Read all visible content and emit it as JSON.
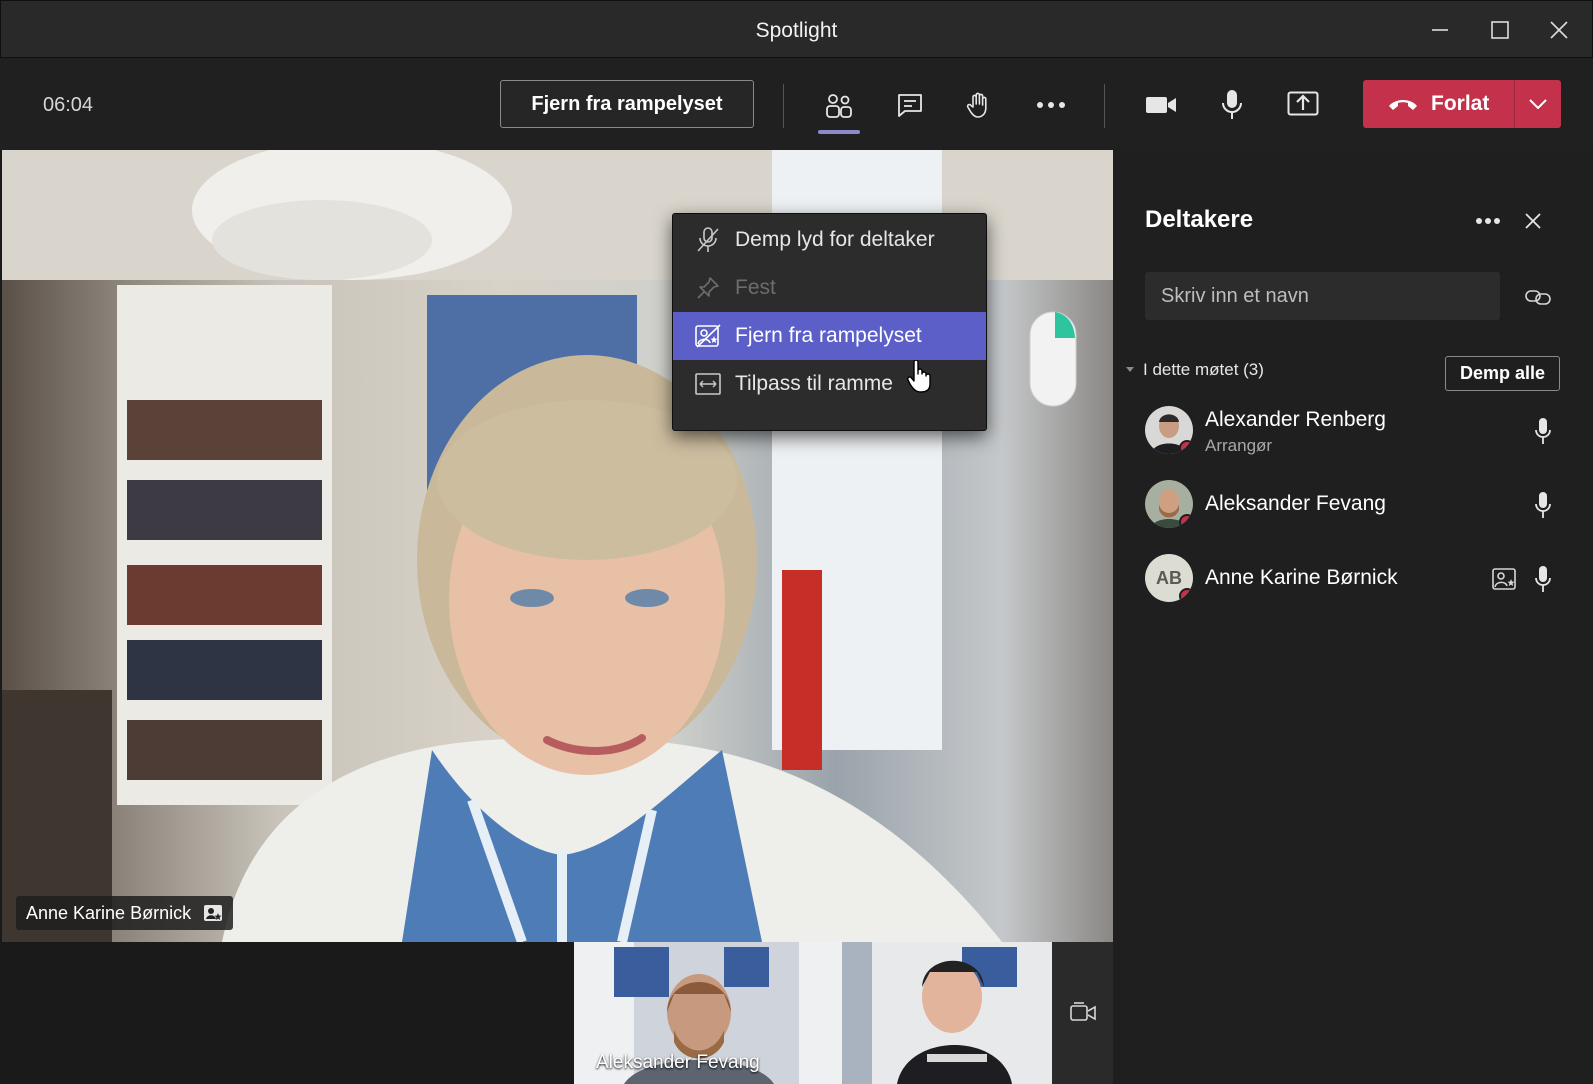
{
  "window": {
    "title": "Spotlight"
  },
  "toolbar": {
    "timer": "06:04",
    "spotlight_button": "Fjern fra rampelyset",
    "leave_label": "Forlat"
  },
  "main_video": {
    "participant_name": "Anne Karine Børnick"
  },
  "thumbnails": [
    {
      "name": "Aleksander Fevang"
    },
    {
      "name": ""
    }
  ],
  "context_menu": {
    "items": [
      {
        "label": "Demp lyd for deltaker",
        "icon": "mic-off-icon",
        "state": "normal"
      },
      {
        "label": "Fest",
        "icon": "pin-icon",
        "state": "disabled"
      },
      {
        "label": "Fjern fra rampelyset",
        "icon": "spotlight-remove-icon",
        "state": "selected"
      },
      {
        "label": "Tilpass til ramme",
        "icon": "fit-frame-icon",
        "state": "normal"
      }
    ]
  },
  "participants_panel": {
    "title": "Deltakere",
    "search_placeholder": "Skriv inn et navn",
    "section_label": "I dette møtet (3)",
    "mute_all_label": "Demp alle",
    "people": [
      {
        "name": "Alexander Renberg",
        "role": "Arrangør",
        "initials": ""
      },
      {
        "name": "Aleksander Fevang",
        "role": "",
        "initials": ""
      },
      {
        "name": "Anne Karine Børnick",
        "role": "",
        "initials": "AB"
      }
    ]
  },
  "colors": {
    "accent": "#5b5fc7",
    "leave": "#c4314b",
    "status_dot": "#c4314b",
    "panel_bg": "#1f1f1f"
  }
}
